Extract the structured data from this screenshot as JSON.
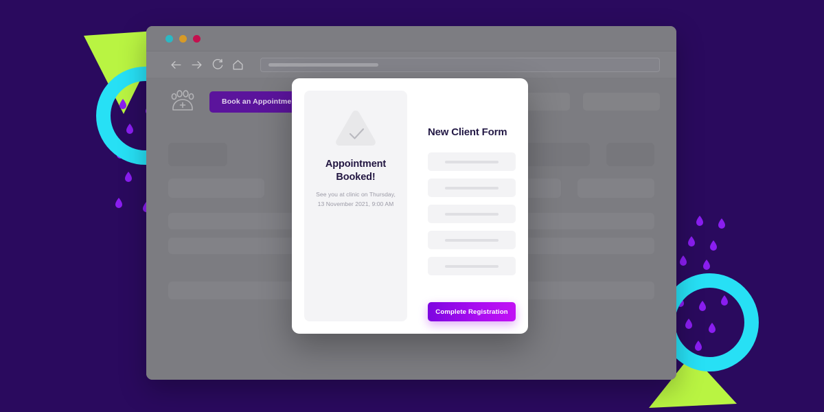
{
  "theme": {
    "background": "#2a0a5e",
    "accent_purple": "#7d05e0",
    "accent_magenta": "#c211f5",
    "accent_cyan": "#27e0f5",
    "accent_lime": "#b9f442",
    "dot_purple": "#8a1ef0",
    "browser_chrome": "#7b7b80",
    "modal_surface": "#ffffff",
    "panel_surface": "#f4f4f6"
  },
  "browser": {
    "traffic_lights": [
      {
        "name": "close-light",
        "color": "#2bb8c4"
      },
      {
        "name": "minimize-light",
        "color": "#d79a27"
      },
      {
        "name": "maximize-light",
        "color": "#c4104e"
      }
    ],
    "toolbar_icons": [
      "back-arrow-icon",
      "forward-arrow-icon",
      "reload-icon",
      "home-icon"
    ],
    "address_bar": {
      "value": "",
      "placeholder": ""
    }
  },
  "page": {
    "logo_icon": "paw-plus-icon",
    "primary_button": "Book an Appointment",
    "nav_placeholders": 2,
    "content_placeholder_rows": 5
  },
  "modal": {
    "confirmation": {
      "icon": "check-triangle-icon",
      "title": "Appointment Booked!",
      "subtitle": "See you at clinic on Thursday, 13 November 2021, 9:00 AM"
    },
    "form": {
      "title": "New Client Form",
      "fields": [
        {
          "name": "field-1",
          "value": "",
          "placeholder": ""
        },
        {
          "name": "field-2",
          "value": "",
          "placeholder": ""
        },
        {
          "name": "field-3",
          "value": "",
          "placeholder": ""
        },
        {
          "name": "field-4",
          "value": "",
          "placeholder": ""
        },
        {
          "name": "field-5",
          "value": "",
          "placeholder": ""
        }
      ],
      "submit_label": "Complete Registration"
    }
  }
}
